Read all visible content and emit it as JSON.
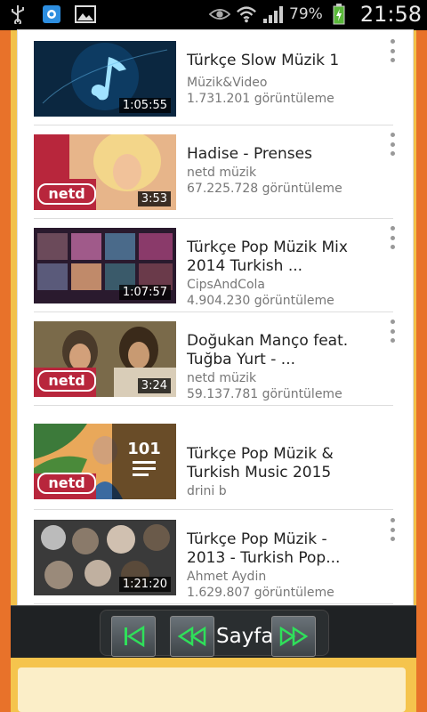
{
  "status_bar": {
    "battery_percent": "79%",
    "time": "21:58"
  },
  "videos": [
    {
      "title": "Türkçe Slow Müzik 1",
      "channel": "Müzik&Video",
      "views": "1.731.201 görüntüleme",
      "duration": "1:05:55",
      "thumb_color": "#0b2740"
    },
    {
      "title": "Hadise - Prenses",
      "channel": "netd müzik",
      "views": "67.225.728 görüntüleme",
      "duration": "3:53",
      "thumb_color": "#b8263c"
    },
    {
      "title": "Türkçe Pop Müzik Mix 2014 Turkish ...",
      "channel": "CipsAndCola",
      "views": "4.904.230 görüntüleme",
      "duration": "1:07:57",
      "thumb_color": "#2a1a2e"
    },
    {
      "title": "Doğukan Manço feat. Tuğba Yurt - ...",
      "channel": "netd müzik",
      "views": "59.137.781 görüntüleme",
      "duration": "3:24",
      "thumb_color": "#7a6a4a"
    },
    {
      "title": "Türkçe Pop Müzik & Turkish Music 2015",
      "channel": "drini b",
      "views": "",
      "duration": "",
      "playlist_count": "101",
      "thumb_color": "#3c7a3a"
    },
    {
      "title": "Türkçe Pop Müzik - 2013 - Turkish Pop...",
      "channel": "Ahmet Aydin",
      "views": "1.629.807 görüntüleme",
      "duration": "1:21:20",
      "thumb_color": "#3a3a3a"
    }
  ],
  "netd_logo": "netd",
  "nav": {
    "label": "Sayfa"
  },
  "colors": {
    "accent_orange": "#e8722a",
    "background_yellow": "#f2c14a",
    "nav_green": "#2fe05a"
  }
}
